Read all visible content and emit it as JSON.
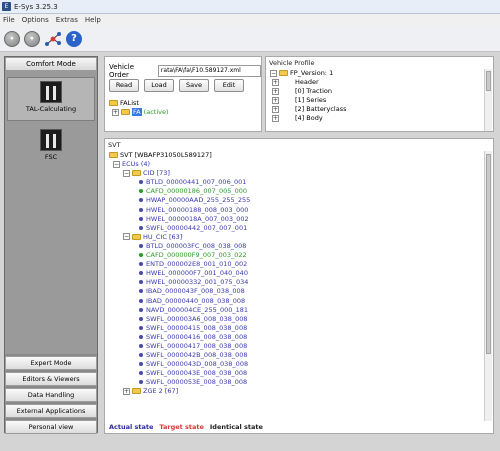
{
  "window": {
    "title": "E-Sys 3.25.3"
  },
  "menu": {
    "items": [
      "File",
      "Options",
      "Extras",
      "Help"
    ]
  },
  "sidebar": {
    "header": "Comfort Mode",
    "tools": [
      {
        "label": "TAL-Calculating"
      },
      {
        "label": "FSC"
      }
    ],
    "buttons": [
      "Expert Mode",
      "Editors & Viewers",
      "Data Handling",
      "External Applications",
      "Personal view"
    ]
  },
  "vehicle_order": {
    "label": "Vehicle Order",
    "file_value": "rata\\FA\\fa\\F10.589127.xml",
    "buttons": [
      "Read",
      "Load",
      "Save",
      "Edit"
    ],
    "tree_root": "FAList",
    "tree_child": "FA",
    "tree_child_state": "(active)"
  },
  "vehicle_profile": {
    "title": "Vehicle Profile",
    "root": "FP_Version: 1",
    "items": [
      "Header",
      "[0] Traction",
      "[1] Series",
      "[2] Batteryclass",
      "[4] Body"
    ]
  },
  "svt": {
    "title": "SVT",
    "root": "SVT [WBAFP31050L589127]",
    "ecus": "ECUs (4)",
    "groups": [
      {
        "name": "CID [73]",
        "items": [
          {
            "text": "BTLD_00000441_007_006_001",
            "state": "actual"
          },
          {
            "text": "CAFD_00000186_007_005_000",
            "state": "identical"
          },
          {
            "text": "HWAP_00000AAD_255_255_255",
            "state": "actual"
          },
          {
            "text": "HWEL_00000188_008_003_000",
            "state": "actual"
          },
          {
            "text": "HWEL_0000018A_007_003_002",
            "state": "actual"
          },
          {
            "text": "SWFL_00000442_007_007_001",
            "state": "actual"
          }
        ]
      },
      {
        "name": "HU_CIC [63]",
        "items": [
          {
            "text": "BTLD_000003FC_008_038_008",
            "state": "actual"
          },
          {
            "text": "CAFD_000000F9_007_003_022",
            "state": "identical"
          },
          {
            "text": "ENTD_000002E8_001_010_002",
            "state": "actual"
          },
          {
            "text": "HWEL_000000F7_001_040_040",
            "state": "actual"
          },
          {
            "text": "HWEL_00000332_001_075_034",
            "state": "actual"
          },
          {
            "text": "IBAD_0000043F_008_038_008",
            "state": "actual"
          },
          {
            "text": "IBAD_00000440_008_038_008",
            "state": "actual"
          },
          {
            "text": "NAVD_000004CE_255_000_181",
            "state": "actual"
          },
          {
            "text": "SWFL_000003A6_008_038_008",
            "state": "actual"
          },
          {
            "text": "SWFL_00000415_008_038_008",
            "state": "actual"
          },
          {
            "text": "SWFL_00000416_008_038_008",
            "state": "actual"
          },
          {
            "text": "SWFL_00000417_008_038_008",
            "state": "actual"
          },
          {
            "text": "SWFL_0000042B_008_038_008",
            "state": "actual"
          },
          {
            "text": "SWFL_0000043D_008_038_008",
            "state": "actual"
          },
          {
            "text": "SWFL_0000043E_008_038_008",
            "state": "actual"
          },
          {
            "text": "SWFL_0000053E_008_038_008",
            "state": "actual"
          }
        ]
      },
      {
        "name": "ZGE 2 [67]",
        "items": []
      }
    ],
    "legend": {
      "actual": "Actual state",
      "target": "Target state",
      "identical": "Identical state"
    }
  },
  "colors": {
    "actual": "#2a2aa0",
    "target": "#d63a3a",
    "identical": "#222222"
  }
}
